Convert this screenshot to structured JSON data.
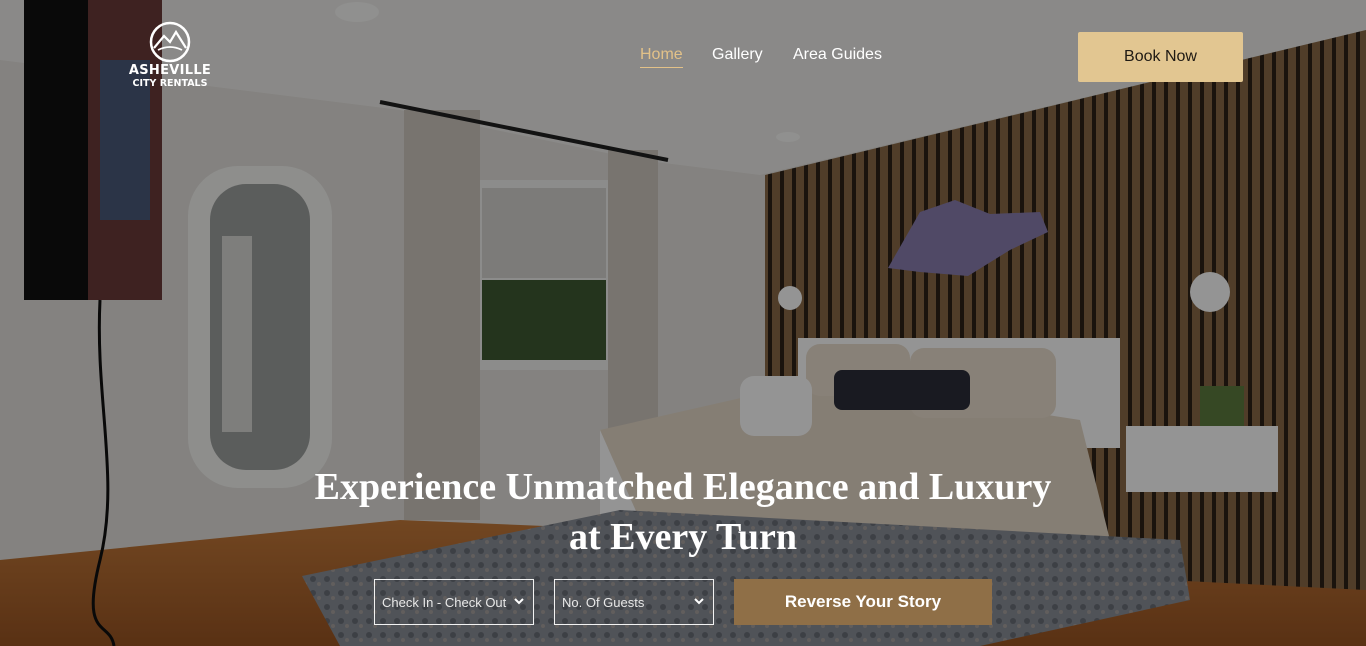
{
  "brand": {
    "line1": "ASHEVILLE",
    "line2": "CITY RENTALS",
    "logo_icon": "mountain-emblem-icon"
  },
  "nav": {
    "items": [
      {
        "label": "Home",
        "active": true
      },
      {
        "label": "Gallery",
        "active": false
      },
      {
        "label": "Area Guides",
        "active": false
      }
    ]
  },
  "book_button": {
    "label": "Book Now"
  },
  "hero": {
    "headline_line1": "Experience Unmatched Elegance and Luxury",
    "headline_line2": "at Every Turn"
  },
  "search": {
    "dates": {
      "value": "Check In - Check Out",
      "icon": "chevron-down-icon"
    },
    "guests": {
      "value": "No. Of Guests",
      "icon": "chevron-down-icon"
    },
    "submit_label": "Reverse Your Story"
  },
  "colors": {
    "accent": "#e2c691",
    "nav_active": "#e2c188",
    "cta": "#8f6f47"
  }
}
